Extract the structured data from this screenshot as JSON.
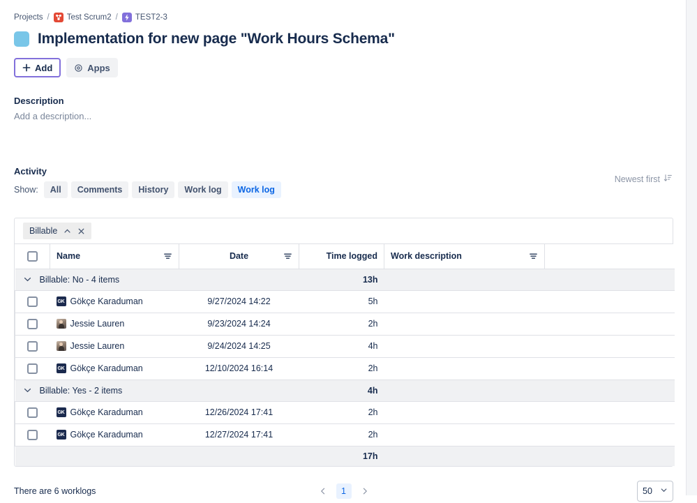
{
  "breadcrumb": {
    "projects_label": "Projects",
    "project_label": "Test Scrum2",
    "issue_label": "TEST2-3",
    "separator": "/"
  },
  "header": {
    "title": "Implementation for new page \"Work Hours Schema\"",
    "title_icon": "task-square-icon",
    "title_icon_color": "#79C6E8"
  },
  "toolbar": {
    "add_label": "Add",
    "add_icon": "plus-icon",
    "apps_label": "Apps",
    "apps_icon": "apps-gear-icon",
    "add_border_color": "#8270DB"
  },
  "description": {
    "section_label": "Description",
    "placeholder": "Add a description..."
  },
  "activity": {
    "section_label": "Activity",
    "show_label": "Show:",
    "tabs": [
      {
        "label": "All",
        "active": false
      },
      {
        "label": "Comments",
        "active": false
      },
      {
        "label": "History",
        "active": false
      },
      {
        "label": "Work log",
        "active": false
      },
      {
        "label": "Work log",
        "active": true
      }
    ],
    "sort_label": "Newest first",
    "sort_icon": "sort-descending-icon"
  },
  "worklog_table": {
    "filter_chip": {
      "label": "Billable",
      "collapse_icon": "chevron-up-icon",
      "remove_icon": "close-icon"
    },
    "columns": [
      {
        "key": "check",
        "label": "",
        "filter": false
      },
      {
        "key": "name",
        "label": "Name",
        "filter": true
      },
      {
        "key": "date",
        "label": "Date",
        "filter": true
      },
      {
        "key": "time",
        "label": "Time logged",
        "filter": false
      },
      {
        "key": "desc",
        "label": "Work description",
        "filter": true
      },
      {
        "key": "pad",
        "label": "",
        "filter": false
      }
    ],
    "groups": [
      {
        "label": "Billable: No - 4 items",
        "total": "13h",
        "expanded": true,
        "rows": [
          {
            "name": "Gökçe Karaduman",
            "avatar": "avatar-initials-gk",
            "initials": "GK",
            "date": "9/27/2024 14:22",
            "time": "5h",
            "desc": ""
          },
          {
            "name": "Jessie Lauren",
            "avatar": "avatar-photo",
            "initials": "",
            "date": "9/23/2024 14:24",
            "time": "2h",
            "desc": ""
          },
          {
            "name": "Jessie Lauren",
            "avatar": "avatar-photo",
            "initials": "",
            "date": "9/24/2024 14:25",
            "time": "4h",
            "desc": ""
          },
          {
            "name": "Gökçe Karaduman",
            "avatar": "avatar-initials-gk",
            "initials": "GK",
            "date": "12/10/2024 16:14",
            "time": "2h",
            "desc": ""
          }
        ]
      },
      {
        "label": "Billable: Yes - 2 items",
        "total": "4h",
        "expanded": true,
        "rows": [
          {
            "name": "Gökçe Karaduman",
            "avatar": "avatar-initials-gk",
            "initials": "GK",
            "date": "12/26/2024 17:41",
            "time": "2h",
            "desc": ""
          },
          {
            "name": "Gökçe Karaduman",
            "avatar": "avatar-initials-gk",
            "initials": "GK",
            "date": "12/27/2024 17:41",
            "time": "2h",
            "desc": ""
          }
        ]
      }
    ],
    "grand_total": "17h"
  },
  "footer": {
    "count_text": "There are 6 worklogs",
    "prev_icon": "chevron-left-icon",
    "next_icon": "chevron-right-icon",
    "current_page": "1",
    "page_size": "50",
    "page_size_icon": "chevron-down-icon"
  }
}
